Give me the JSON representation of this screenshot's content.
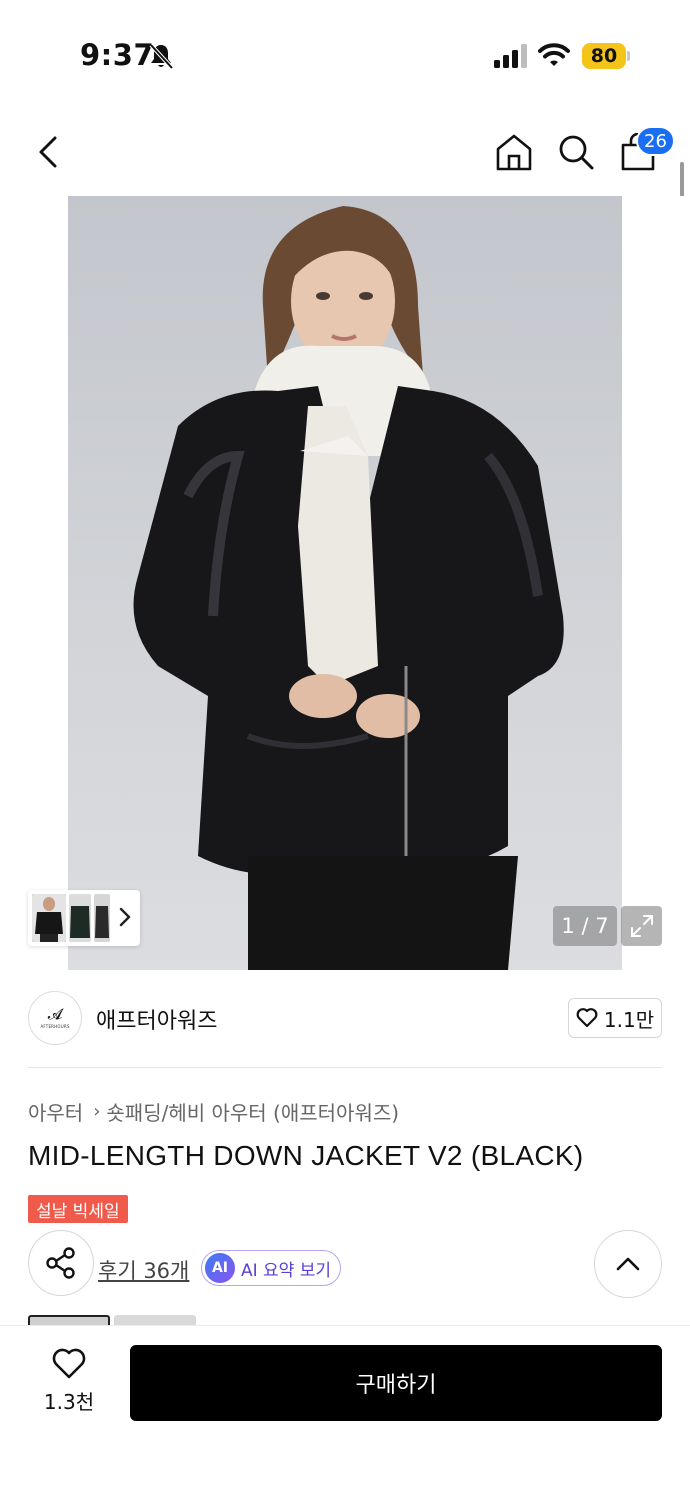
{
  "status_bar": {
    "time": "9:37",
    "battery": "80",
    "icons": [
      "bell-slash-icon",
      "signal-icon",
      "wifi-icon",
      "battery-icon"
    ],
    "battery_color": "#f5c418"
  },
  "nav": {
    "icons": [
      "back-arrow-icon",
      "home-icon",
      "search-icon",
      "shopping-bag-icon"
    ],
    "cart_count": "26",
    "badge_color": "#1a6ef2"
  },
  "gallery": {
    "counter": "1 / 7",
    "expand_icon": "expand-icon",
    "thumb_arrow_icon": "chevron-right-icon"
  },
  "brand": {
    "name": "애프터아워즈",
    "logo_mark": "𝓐",
    "logo_text": "AFTERHOURS",
    "likes": "1.1만"
  },
  "breadcrumb": {
    "category": "아우터",
    "subcategory": "숏패딩/헤비 아우터 (애프터아워즈)"
  },
  "product": {
    "title": "MID-LENGTH DOWN JACKET V2 (BLACK)",
    "sale_badge": "설날 빅세일",
    "sale_color": "#f05a4a"
  },
  "actions": {
    "reviews": "후기 36개",
    "ai_badge": "AI",
    "ai_summary": "AI 요약 보기",
    "share_icon": "share-icon",
    "top_icon": "chevron-up-icon"
  },
  "bottom_bar": {
    "wish_count": "1.3천",
    "buy_label": "구매하기"
  }
}
